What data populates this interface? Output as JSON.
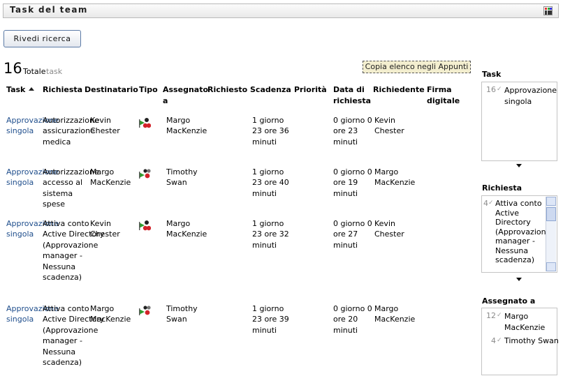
{
  "header": {
    "title": "Task del team",
    "customize_icon": "grid-icon"
  },
  "toolbar": {
    "review_search_label": "Rivedi ricerca",
    "copy_label": "Copia elenco negli Appunti"
  },
  "summary": {
    "count": "16",
    "total_label": "Totale",
    "unit_label": "task"
  },
  "table": {
    "columns": [
      "Task",
      "Richiesta",
      "Destinatario",
      "Tipo",
      "Assegnato a",
      "Richiesto",
      "Scadenza",
      "Priorità",
      "Data di richiesta",
      "Richiedente",
      "Firma digitale"
    ],
    "rows": [
      {
        "task": "Approvazione singola",
        "request": "Autorizzazione assicurazione medica",
        "recipient": "Kevin Chester",
        "type_icon": "person-group-flag-icon",
        "assigned": "Margo MacKenzie",
        "requested": "",
        "deadline": "1 giorno 23 ore 36 minuti",
        "priority": "",
        "request_date": "0 giorno 0 ore 23 minuti",
        "requester": "Kevin Chester",
        "signature": ""
      },
      {
        "task": "Approvazione singola",
        "request": "Autorizzazione accesso al sistema spese",
        "recipient": "Margo MacKenzie",
        "type_icon": "group-flag-icon",
        "assigned": "Timothy Swan",
        "requested": "",
        "deadline": "1 giorno 23 ore 40 minuti",
        "priority": "",
        "request_date": "0 giorno 0 ore 19 minuti",
        "requester": "Margo MacKenzie",
        "signature": ""
      },
      {
        "task": "Approvazione singola",
        "request": "Attiva conto Active Directory (Approvazione manager - Nessuna scadenza)",
        "recipient": "Kevin Chester",
        "type_icon": "person-group-flag-icon",
        "assigned": "Margo MacKenzie",
        "requested": "",
        "deadline": "1 giorno 23 ore 32 minuti",
        "priority": "",
        "request_date": "0 giorno 0 ore 27 minuti",
        "requester": "Kevin Chester",
        "signature": ""
      },
      {
        "task": "Approvazione singola",
        "request": "Attiva conto Active Directory (Approvazione manager - Nessuna scadenza)",
        "recipient": "Margo MacKenzie",
        "type_icon": "group-flag-icon",
        "assigned": "Timothy Swan",
        "requested": "",
        "deadline": "1 giorno 23 ore 39 minuti",
        "priority": "",
        "request_date": "0 giorno 0 ore 20 minuti",
        "requester": "Margo MacKenzie",
        "signature": ""
      }
    ]
  },
  "sidebar": {
    "task": {
      "title": "Task",
      "items": [
        {
          "count": "16",
          "label": "Approvazione singola"
        }
      ]
    },
    "request": {
      "title": "Richiesta",
      "items": [
        {
          "count": "4",
          "label": "Attiva conto Active Directory (Approvazione manager - Nessuna scadenza)"
        }
      ]
    },
    "assigned": {
      "title": "Assegnato a",
      "items": [
        {
          "count": "12",
          "label": "Margo MacKenzie"
        },
        {
          "count": "4",
          "label": "Timothy Swan"
        }
      ]
    }
  }
}
